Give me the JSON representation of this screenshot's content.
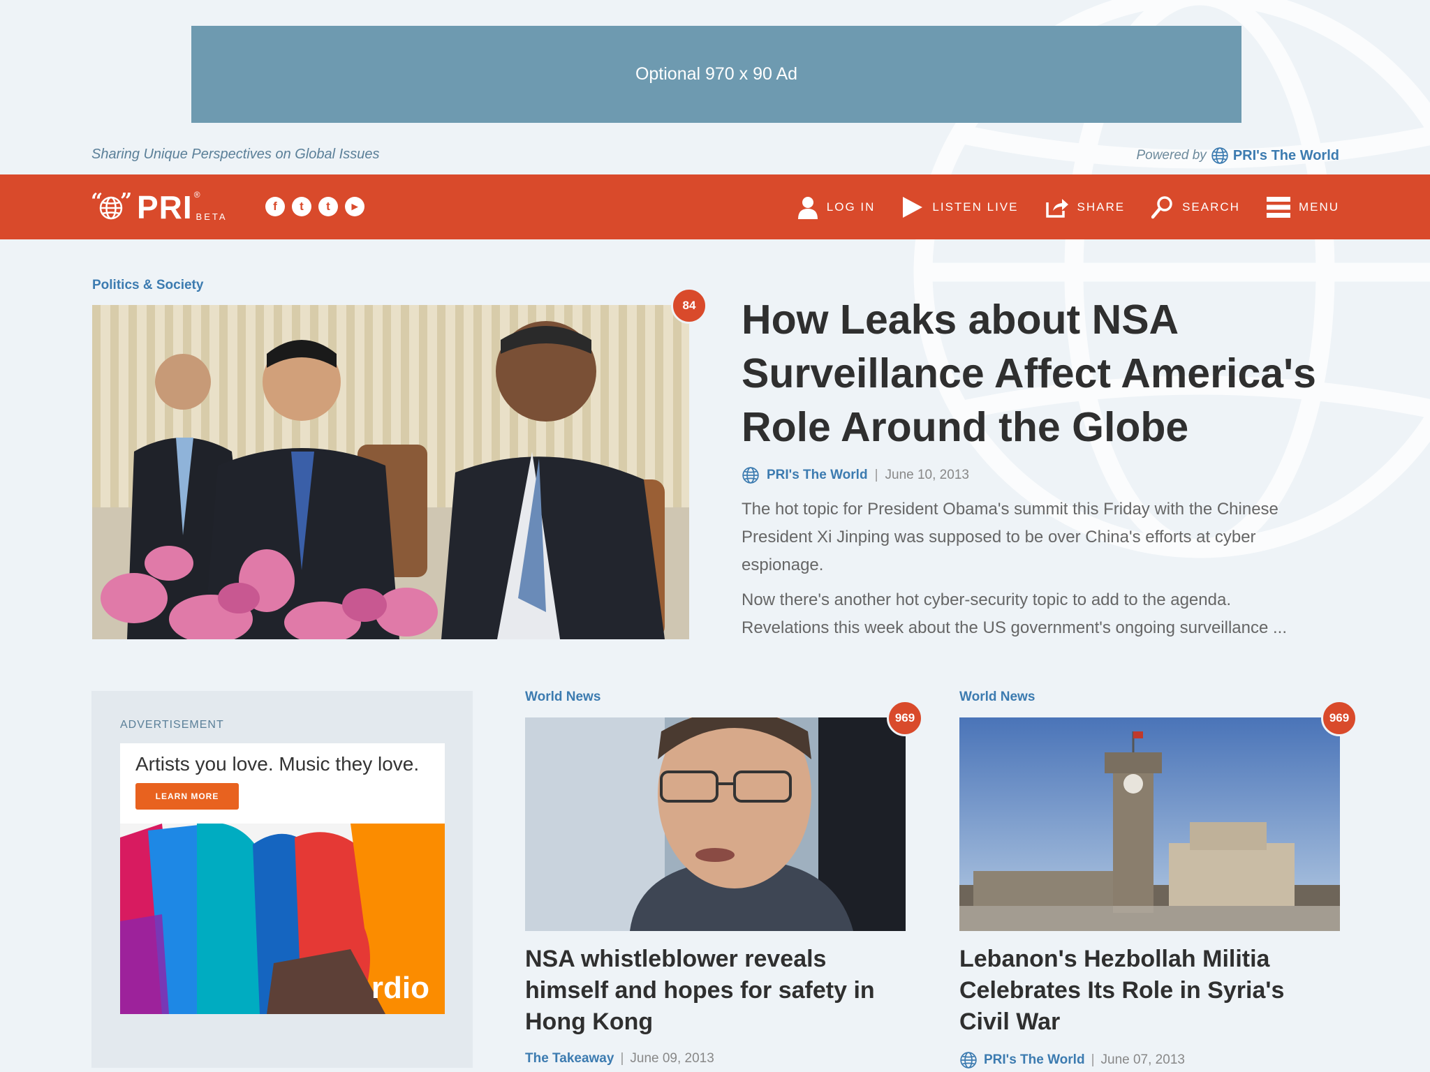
{
  "top_ad": {
    "label": "Optional 970 x 90 Ad"
  },
  "tagline": "Sharing Unique Perspectives on Global Issues",
  "powered": {
    "prefix": "Powered by",
    "brand": "PRI's The World"
  },
  "nav": {
    "logo": {
      "quote": "“●”",
      "text": "PRI",
      "reg": "®",
      "beta": "BETA"
    },
    "social": [
      {
        "glyph": "f",
        "name": "facebook"
      },
      {
        "glyph": "t",
        "name": "twitter"
      },
      {
        "glyph": "t",
        "name": "tumblr"
      },
      {
        "glyph": "▸",
        "name": "youtube"
      }
    ],
    "links": [
      {
        "label": "LOG IN",
        "icon": "user-icon"
      },
      {
        "label": "LISTEN LIVE",
        "icon": "play-icon"
      },
      {
        "label": "SHARE",
        "icon": "share-icon"
      },
      {
        "label": "SEARCH",
        "icon": "search-icon"
      },
      {
        "label": "MENU",
        "icon": "menu-icon"
      }
    ]
  },
  "hero": {
    "category": "Politics & Society",
    "comments": "84",
    "title": "How Leaks about NSA Surveillance Affect America's Role Around the Globe",
    "source": "PRI's The World",
    "date": "June 10, 2013",
    "para1": "The hot topic for President Obama's summit this Friday with the Chinese President Xi Jinping was supposed to be over China's efforts at cyber espionage.",
    "para2": "Now there's another hot cyber-security topic to add to the agenda. Revelations this week about the US government's ongoing surveillance ..."
  },
  "ad": {
    "label": "ADVERTISEMENT",
    "headline": "Artists you love. Music they love.",
    "button": "LEARN MORE",
    "brand": "rdio"
  },
  "cards": [
    {
      "category": "World News",
      "comments": "969",
      "title": "NSA whistleblower reveals himself and hopes for safety in Hong Kong",
      "source": "The Takeaway",
      "date": "June 09, 2013"
    },
    {
      "category": "World News",
      "comments": "969",
      "title": "Lebanon's Hezbollah Militia Celebrates Its Role in Syria's Civil War",
      "source": "PRI's The World",
      "date": "June 07, 2013"
    }
  ],
  "colors": {
    "accent": "#d94a2b",
    "link": "#3c7bb0",
    "ad": "#6e9ab0",
    "background": "#eef3f7"
  }
}
